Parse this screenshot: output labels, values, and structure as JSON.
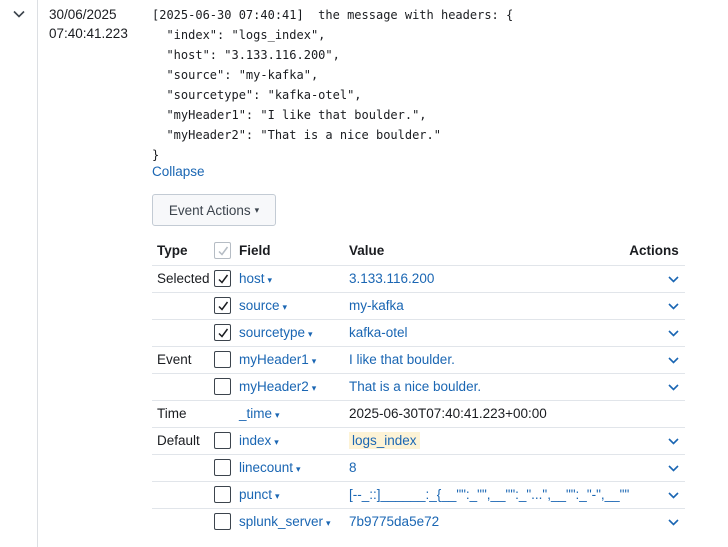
{
  "event": {
    "date": "30/06/2025",
    "time": "07:40:41.223",
    "raw": "[2025-06-30 07:40:41]  the message with headers: {\n  \"index\": \"logs_index\",\n  \"host\": \"3.133.116.200\",\n  \"source\": \"my-kafka\",\n  \"sourcetype\": \"kafka-otel\",\n  \"myHeader1\": \"I like that boulder.\",\n  \"myHeader2\": \"That is a nice boulder.\"\n}",
    "collapse_label": "Collapse",
    "event_actions_label": "Event Actions",
    "event_actions_caret": "▾"
  },
  "table": {
    "headers": {
      "type": "Type",
      "field": "Field",
      "value": "Value",
      "actions": "Actions"
    },
    "rows": [
      {
        "type": "Selected",
        "checkbox": true,
        "checked": true,
        "field": "host",
        "value": "3.133.116.200",
        "value_style": "link"
      },
      {
        "type": "",
        "checkbox": true,
        "checked": true,
        "field": "source",
        "value": "my-kafka",
        "value_style": "link"
      },
      {
        "type": "",
        "checkbox": true,
        "checked": true,
        "field": "sourcetype",
        "value": "kafka-otel",
        "value_style": "link"
      },
      {
        "type": "Event",
        "checkbox": true,
        "checked": false,
        "field": "myHeader1",
        "value": "I like that boulder.",
        "value_style": "link"
      },
      {
        "type": "",
        "checkbox": true,
        "checked": false,
        "field": "myHeader2",
        "value": "That is a nice boulder.",
        "value_style": "link"
      },
      {
        "type": "Time",
        "checkbox": false,
        "checked": false,
        "field": "_time",
        "value": "2025-06-30T07:40:41.223+00:00",
        "value_style": "plain",
        "no_action": true
      },
      {
        "type": "Default",
        "checkbox": true,
        "checked": false,
        "field": "index",
        "value": "logs_index",
        "value_style": "highlight"
      },
      {
        "type": "",
        "checkbox": true,
        "checked": false,
        "field": "linecount",
        "value": "8",
        "value_style": "link"
      },
      {
        "type": "",
        "checkbox": true,
        "checked": false,
        "field": "punct",
        "value": "[--_::]______:_{__\"\":_\"\",__\"\":_\"...\",__\"\":_\"-\",__\"\"",
        "value_style": "link"
      },
      {
        "type": "",
        "checkbox": true,
        "checked": false,
        "field": "splunk_server",
        "value": "7b9775da5e72",
        "value_style": "link"
      }
    ]
  },
  "colors": {
    "link": "#1a66b3",
    "text": "#1a1c20",
    "highlight_bg": "#fdf3d6"
  }
}
